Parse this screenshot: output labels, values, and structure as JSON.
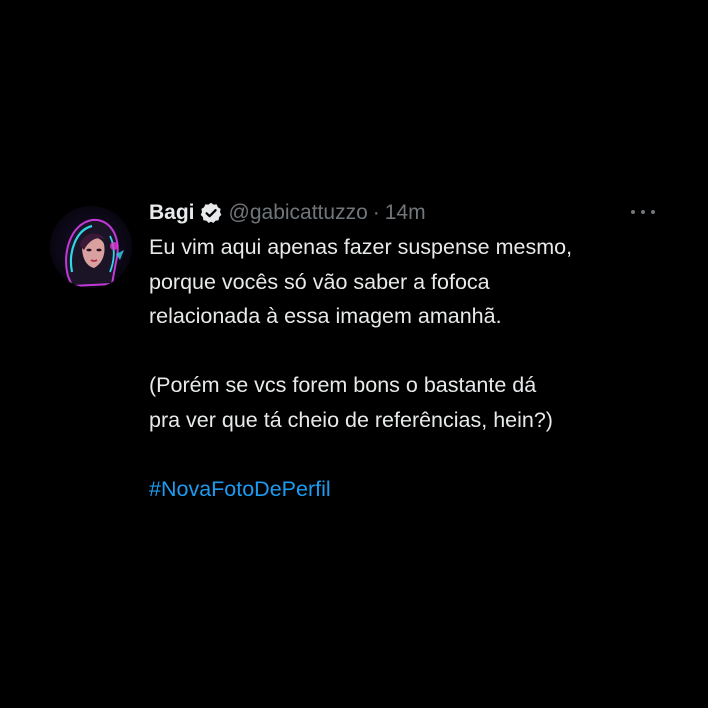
{
  "tweet": {
    "author": {
      "name": "Bagi",
      "handle": "@gabicattuzzo",
      "verified": true,
      "avatar_icon": "avatar-illustration-icon"
    },
    "separator": "·",
    "timestamp": "14m",
    "more_icon": "more-options-icon",
    "paragraph1": [
      "Eu vim aqui apenas fazer suspense mesmo,",
      "porque vocês só vão saber a fofoca",
      "relacionada à essa imagem amanhã."
    ],
    "paragraph2": [
      "(Porém se vcs forem bons o bastante dá",
      "pra ver que tá cheio de referências, hein?)"
    ],
    "hashtag": "#NovaFotoDePerfil"
  },
  "colors": {
    "background": "#000000",
    "text_primary": "#e7e9ea",
    "text_secondary": "#71767b",
    "link": "#1d9bf0",
    "verified_badge": "#e7e9ea"
  }
}
